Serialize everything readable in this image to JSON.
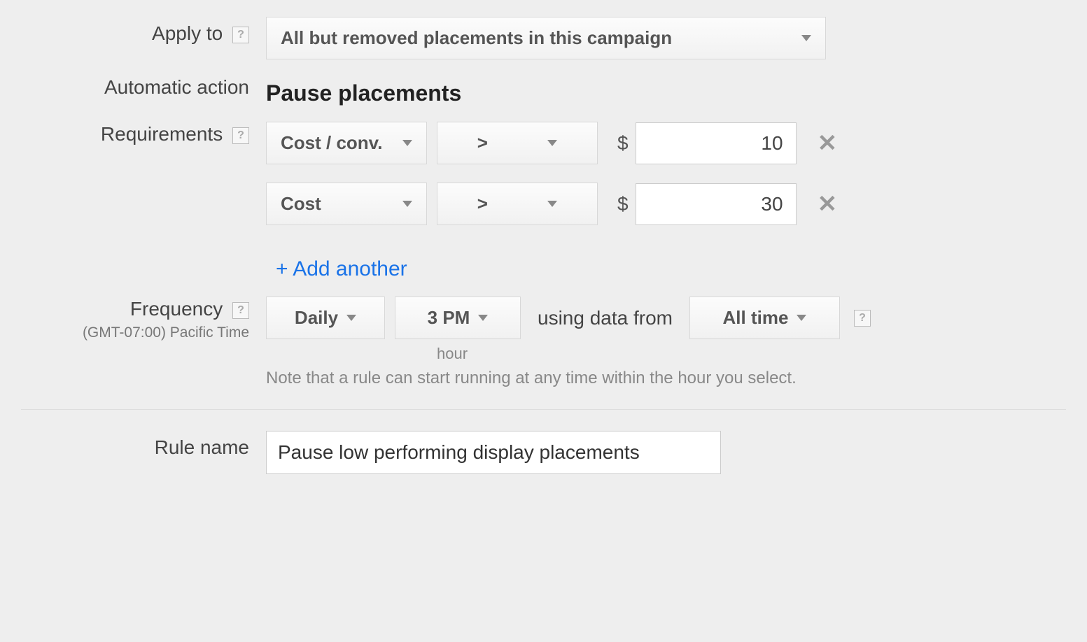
{
  "apply_to": {
    "label": "Apply to",
    "value": "All but removed placements in this campaign"
  },
  "automatic_action": {
    "label": "Automatic action",
    "value": "Pause placements"
  },
  "requirements": {
    "label": "Requirements",
    "rows": [
      {
        "metric": "Cost / conv.",
        "operator": ">",
        "currency": "$",
        "value": "10"
      },
      {
        "metric": "Cost",
        "operator": ">",
        "currency": "$",
        "value": "30"
      }
    ],
    "add_another": "+ Add another"
  },
  "frequency": {
    "label": "Frequency",
    "timezone": "(GMT-07:00) Pacific Time",
    "interval": "Daily",
    "hour": "3 PM",
    "hour_label": "hour",
    "using_text": "using data from",
    "range": "All time",
    "note": "Note that a rule can start running at any time within the hour you select."
  },
  "rule_name": {
    "label": "Rule name",
    "value": "Pause low performing display placements"
  },
  "help_glyph": "?"
}
